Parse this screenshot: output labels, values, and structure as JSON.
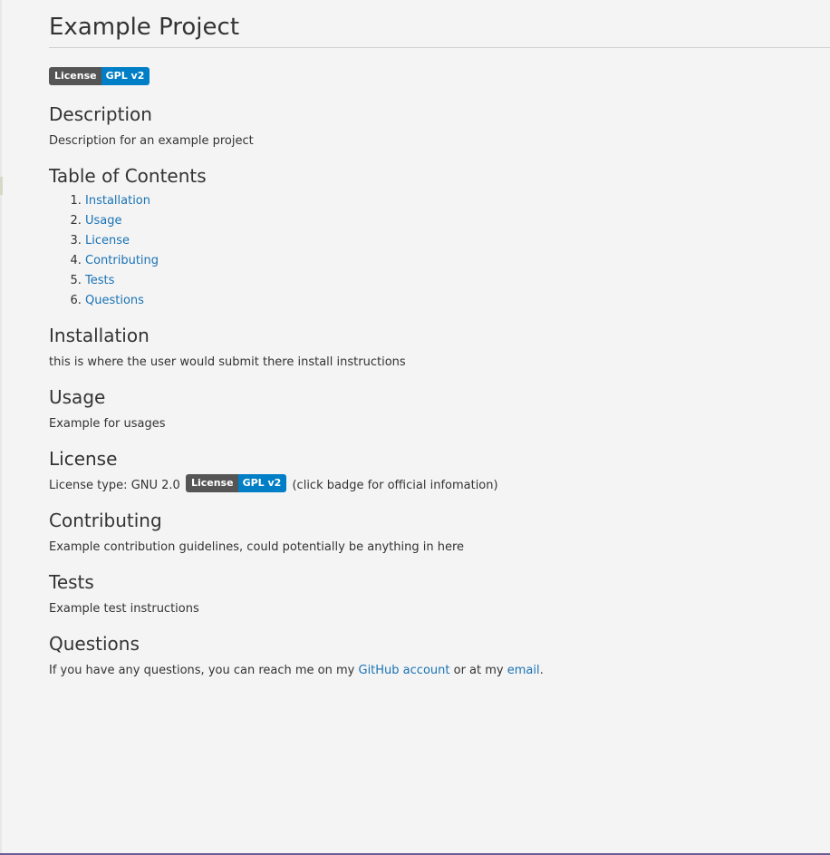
{
  "title": "Example Project",
  "badge": {
    "left": "License",
    "right": "GPL v2"
  },
  "description": {
    "heading": "Description",
    "text": "Description for an example project"
  },
  "toc": {
    "heading": "Table of Contents",
    "items": [
      "Installation",
      "Usage",
      "License",
      "Contributing",
      "Tests",
      "Questions"
    ]
  },
  "installation": {
    "heading": "Installation",
    "text": "this is where the user would submit there install instructions"
  },
  "usage": {
    "heading": "Usage",
    "text": "Example for usages"
  },
  "license": {
    "heading": "License",
    "prefix": "License type: GNU 2.0",
    "suffix": "(click badge for official infomation)"
  },
  "contributing": {
    "heading": "Contributing",
    "text": "Example contribution guidelines, could potentially be anything in here"
  },
  "tests": {
    "heading": "Tests",
    "text": "Example test instructions"
  },
  "questions": {
    "heading": "Questions",
    "prefix": "If you have any questions, you can reach me on my",
    "github_link": "GitHub account",
    "middle": "or at my",
    "email_link": "email",
    "end": "."
  },
  "colors": {
    "badge_left": "#555555",
    "badge_right": "#007ec6",
    "link": "#1a73b5",
    "background": "#f4f4f4"
  }
}
